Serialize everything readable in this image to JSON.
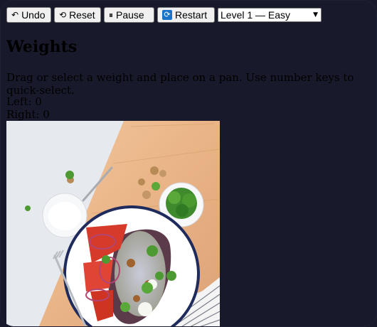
{
  "toolbar": {
    "undo_label": "Undo",
    "reset_label": "Reset",
    "pause_label": "Pause",
    "restart_label": "Restart",
    "level_selected": "Level 1 — Easy"
  },
  "icons": {
    "undo": "undo-arrow-icon",
    "reset": "reset-circular-arrow-icon",
    "pause": "pause-icon",
    "restart": "restart-icon",
    "dropdown": "chevron-down-icon"
  },
  "game": {
    "title": "Weights",
    "instructions": "Drag or select a weight and place on a pan. Use number keys to quick-select.",
    "left_label": "Left: 0",
    "right_label": "Right: 0"
  },
  "colors": {
    "background": "#181a2b",
    "button_bg": "#f0f0f0",
    "restart_icon_bg": "#1a73c8"
  }
}
